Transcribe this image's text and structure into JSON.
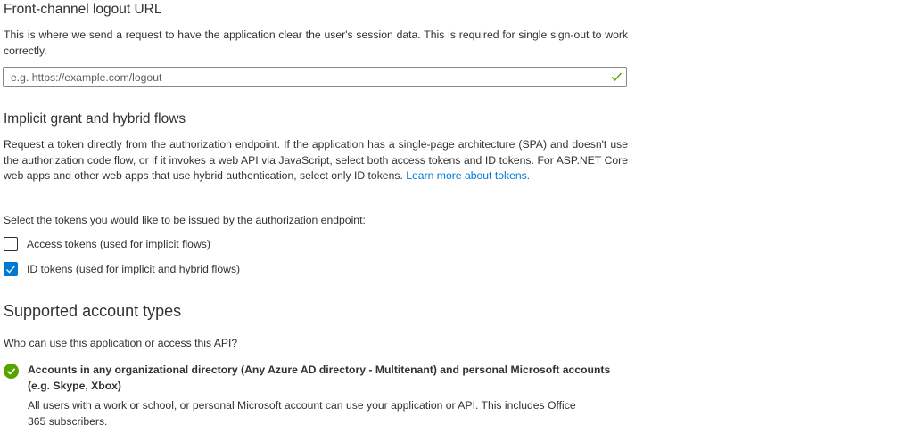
{
  "front_channel": {
    "title": "Front-channel logout URL",
    "description": "This is where we send a request to have the application clear the user's session data. This is required for single sign-out to work correctly.",
    "input_placeholder": "e.g. https://example.com/logout",
    "input_value": ""
  },
  "implicit_grant": {
    "title": "Implicit grant and hybrid flows",
    "description": "Request a token directly from the authorization endpoint. If the application has a single-page architecture (SPA) and doesn't use the authorization code flow, or if it invokes a web API via JavaScript, select both access tokens and ID tokens. For ASP.NET Core web apps and other web apps that use hybrid authentication, select only ID tokens.",
    "learn_more_link": "Learn more about tokens.",
    "select_prompt": "Select the tokens you would like to be issued by the authorization endpoint:",
    "checkboxes": [
      {
        "label": "Access tokens (used for implicit flows)",
        "checked": false
      },
      {
        "label": "ID tokens (used for implicit and hybrid flows)",
        "checked": true
      }
    ]
  },
  "account_types": {
    "title": "Supported account types",
    "question": "Who can use this application or access this API?",
    "selected_option": {
      "title": "Accounts in any organizational directory (Any Azure AD directory - Multitenant) and personal Microsoft accounts (e.g. Skype, Xbox)",
      "description": "All users with a work or school, or personal Microsoft account can use your application or API. This includes Office 365 subscribers."
    }
  },
  "colors": {
    "accent": "#0078d4",
    "success": "#57a300",
    "text": "#323130",
    "border": "#8a8886"
  },
  "icons": {
    "input_valid": "checkmark-icon",
    "checkbox_checked": "checkmark-icon",
    "option_selected": "check-circle-icon"
  }
}
